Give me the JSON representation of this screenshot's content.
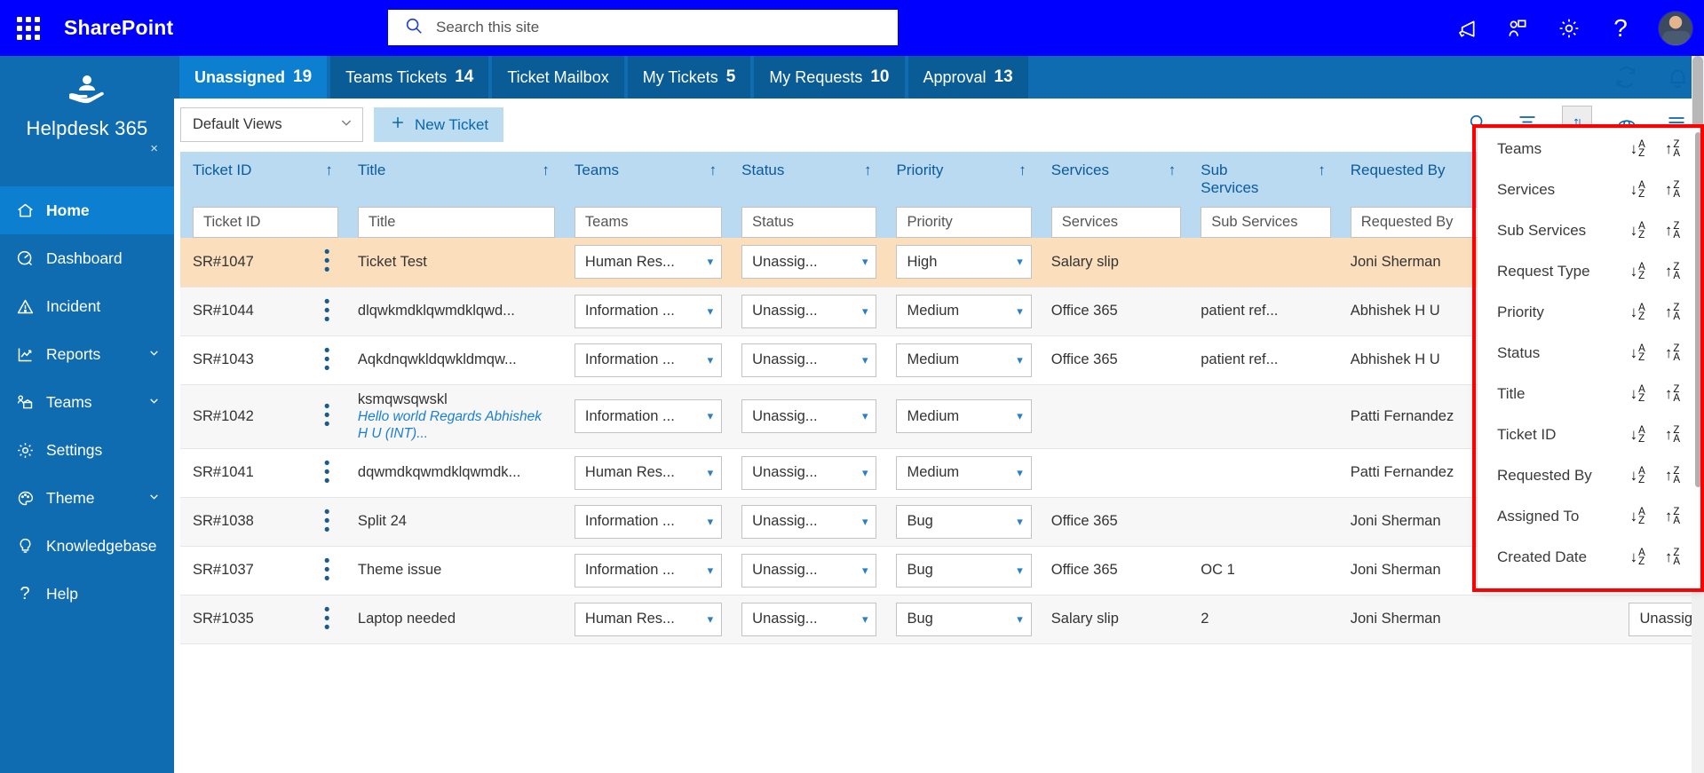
{
  "suite": {
    "app_launcher": "waffle-icon",
    "brand": "SharePoint",
    "search_placeholder": "Search this site",
    "icons": [
      "megaphone-icon",
      "collaborate-icon",
      "gear-icon",
      "help-icon"
    ]
  },
  "sidebar": {
    "title": "Helpdesk 365",
    "close": "×",
    "items": [
      {
        "label": "Home",
        "icon": "home-icon",
        "active": true,
        "chevron": false
      },
      {
        "label": "Dashboard",
        "icon": "dashboard-icon",
        "active": false,
        "chevron": false
      },
      {
        "label": "Incident",
        "icon": "warning-icon",
        "active": false,
        "chevron": false
      },
      {
        "label": "Reports",
        "icon": "chart-icon",
        "active": false,
        "chevron": true
      },
      {
        "label": "Teams",
        "icon": "teams-icon",
        "active": false,
        "chevron": true
      },
      {
        "label": "Settings",
        "icon": "gear-icon",
        "active": false,
        "chevron": false
      },
      {
        "label": "Theme",
        "icon": "palette-icon",
        "active": false,
        "chevron": true
      },
      {
        "label": "Knowledgebase",
        "icon": "lightbulb-icon",
        "active": false,
        "chevron": false
      },
      {
        "label": "Help",
        "icon": "question-icon",
        "active": false,
        "chevron": false
      }
    ]
  },
  "tabs": [
    {
      "label": "Unassigned",
      "count": "19",
      "active": true
    },
    {
      "label": "Teams Tickets",
      "count": "14",
      "active": false
    },
    {
      "label": "Ticket Mailbox",
      "count": "",
      "active": false
    },
    {
      "label": "My Tickets",
      "count": "5",
      "active": false
    },
    {
      "label": "My Requests",
      "count": "10",
      "active": false
    },
    {
      "label": "Approval",
      "count": "13",
      "active": false
    }
  ],
  "toolbar": {
    "view_selector_value": "Default Views",
    "new_ticket_label": "New Ticket",
    "new_ticket_icon": "plus-icon",
    "icons": [
      {
        "name": "search-icon",
        "selected": false
      },
      {
        "name": "filter-icon",
        "selected": false
      },
      {
        "name": "sort-icon",
        "selected": true
      },
      {
        "name": "eye-icon",
        "selected": false
      },
      {
        "name": "menu-icon",
        "selected": false
      }
    ],
    "top_icons": [
      {
        "name": "refresh-icon"
      },
      {
        "name": "bell-icon"
      }
    ]
  },
  "table": {
    "columns": [
      {
        "label": "Ticket ID",
        "sort": "↑",
        "placeholder": "Ticket ID"
      },
      {
        "label": "Title",
        "sort": "↑",
        "placeholder": "Title"
      },
      {
        "label": "Teams",
        "sort": "↑",
        "placeholder": "Teams"
      },
      {
        "label": "Status",
        "sort": "↑",
        "placeholder": "Status"
      },
      {
        "label": "Priority",
        "sort": "↑",
        "placeholder": "Priority"
      },
      {
        "label": "Services",
        "sort": "↑",
        "placeholder": "Services"
      },
      {
        "label": "Sub Services",
        "sort": "↑",
        "placeholder": "Sub Services"
      },
      {
        "label": "Requested By",
        "sort": "↑",
        "placeholder": "Requested By"
      }
    ],
    "rows": [
      {
        "ticket_id": "SR#1047",
        "title": "Ticket Test",
        "title_sub": "",
        "teams": "Human Res...",
        "status": "Unassig...",
        "priority": "High",
        "services": "Salary slip",
        "sub_services": "",
        "requested_by": "Joni Sherman",
        "highlight": true
      },
      {
        "ticket_id": "SR#1044",
        "title": "dlqwkmdklqwmdklqwd...",
        "title_sub": "",
        "teams": "Information ...",
        "status": "Unassig...",
        "priority": "Medium",
        "services": "Office 365",
        "sub_services": "patient ref...",
        "requested_by": "Abhishek H U",
        "highlight": false
      },
      {
        "ticket_id": "SR#1043",
        "title": "Aqkdnqwkldqwkldmqw...",
        "title_sub": "",
        "teams": "Information ...",
        "status": "Unassig...",
        "priority": "Medium",
        "services": "Office 365",
        "sub_services": "patient ref...",
        "requested_by": "Abhishek H U",
        "highlight": false
      },
      {
        "ticket_id": "SR#1042",
        "title": "ksmqwsqwskl",
        "title_sub": "Hello world Regards Abhishek H U (INT)...",
        "teams": "Information ...",
        "status": "Unassig...",
        "priority": "Medium",
        "services": "",
        "sub_services": "",
        "requested_by": "Patti Fernandez",
        "highlight": false
      },
      {
        "ticket_id": "SR#1041",
        "title": "dqwmdkqwmdklqwmdk...",
        "title_sub": "",
        "teams": "Human Res...",
        "status": "Unassig...",
        "priority": "Medium",
        "services": "",
        "sub_services": "",
        "requested_by": "Patti Fernandez",
        "highlight": false
      },
      {
        "ticket_id": "SR#1038",
        "title": "Split 24",
        "title_sub": "",
        "teams": "Information ...",
        "status": "Unassig...",
        "priority": "Bug",
        "services": "Office 365",
        "sub_services": "",
        "requested_by": "Joni Sherman",
        "highlight": false
      },
      {
        "ticket_id": "SR#1037",
        "title": "Theme issue",
        "title_sub": "",
        "teams": "Information ...",
        "status": "Unassig...",
        "priority": "Bug",
        "services": "Office 365",
        "sub_services": "OC 1",
        "requested_by": "Joni Sherman",
        "highlight": false
      },
      {
        "ticket_id": "SR#1035",
        "title": "Laptop needed",
        "title_sub": "",
        "teams": "Human Res...",
        "status": "Unassig...",
        "priority": "Bug",
        "services": "Salary slip",
        "sub_services": "2",
        "requested_by": "Joni Sherman",
        "highlight": false
      }
    ],
    "kebab_icon": "more-vertical-icon",
    "bottom_select_value": "Unassigned"
  },
  "sort_panel": {
    "asc_icon": "sort-a-z-icon",
    "desc_icon": "sort-z-a-icon",
    "items": [
      "Teams",
      "Services",
      "Sub Services",
      "Request Type",
      "Priority",
      "Status",
      "Title",
      "Ticket ID",
      "Requested By",
      "Assigned To",
      "Created Date"
    ]
  },
  "colors": {
    "suite_blue": "#0000ff",
    "nav_blue": "#0f6cb0",
    "active_blue": "#0d7fd1",
    "header_blue": "#b9daf0",
    "highlight_row": "#fbdfbd",
    "link_blue": "#1a7fd4",
    "annotation_red": "#ff0000"
  }
}
